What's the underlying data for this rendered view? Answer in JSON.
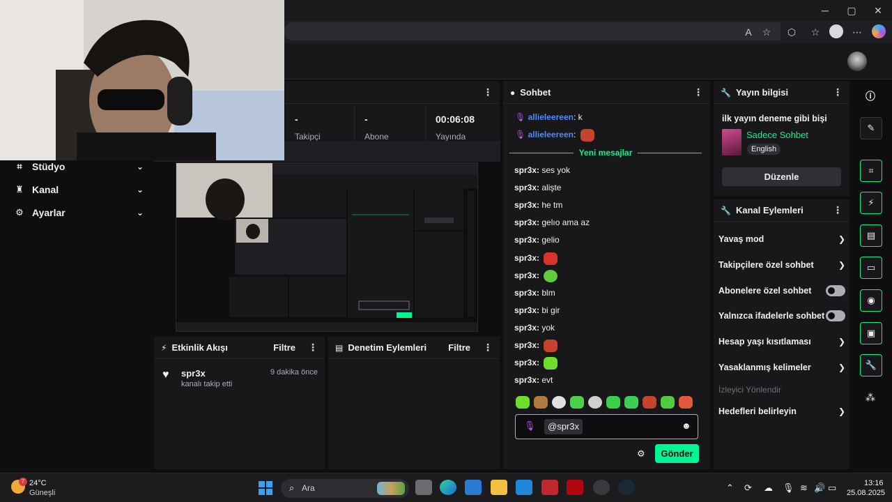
{
  "window": {
    "minimize": "─",
    "maximize": "▢",
    "close": "✕"
  },
  "toolbar": {
    "reader_label": "A",
    "star": "☆",
    "ext": "⬡",
    "fav": "☆",
    "more": "⋯"
  },
  "sidebar": {
    "items": [
      {
        "label": "Stüdyo",
        "icon": "⌗"
      },
      {
        "label": "Kanal",
        "icon": "♜"
      },
      {
        "label": "Ayarlar",
        "icon": "⚙"
      }
    ]
  },
  "stats": {
    "columns": [
      {
        "value": "-",
        "label": "Takipçi"
      },
      {
        "value": "-",
        "label": "Abone"
      },
      {
        "value": "00:06:08",
        "label": "Yayında"
      }
    ]
  },
  "chat": {
    "title": "Sohbet",
    "new_messages": "Yeni mesajlar",
    "top_messages": [
      {
        "user": "allieleereen",
        "text": "k"
      },
      {
        "user": "allieleereen",
        "text": ""
      }
    ],
    "messages": [
      {
        "user": "spr3x:",
        "text": "ses yok"
      },
      {
        "user": "spr3x:",
        "text": "alişte"
      },
      {
        "user": "spr3x:",
        "text": "he tm"
      },
      {
        "user": "spr3x:",
        "text": "gelıo ama az"
      },
      {
        "user": "spr3x:",
        "text": "gelio"
      },
      {
        "user": "spr3x:",
        "text": ""
      },
      {
        "user": "spr3x:",
        "text": ""
      },
      {
        "user": "spr3x:",
        "text": "blm"
      },
      {
        "user": "spr3x:",
        "text": "bi gir"
      },
      {
        "user": "spr3x:",
        "text": "yok"
      },
      {
        "user": "spr3x:",
        "text": ""
      },
      {
        "user": "spr3x:",
        "text": ""
      },
      {
        "user": "spr3x:",
        "text": "evt"
      }
    ],
    "input_value": "@spr3x",
    "send_label": "Gönder"
  },
  "yayin": {
    "title": "Yayın bilgisi",
    "stream_title": "ilk yayın deneme gibi bişi",
    "category": "Sadece Sohbet",
    "language": "English",
    "edit_label": "Düzenle"
  },
  "kanal": {
    "title": "Kanal Eylemleri",
    "rows": [
      {
        "label": "Yavaş mod",
        "kind": "chevron"
      },
      {
        "label": "Takipçilere özel sohbet",
        "kind": "chevron"
      },
      {
        "label": "Abonelere özel sohbet",
        "kind": "toggle"
      },
      {
        "label": "Yalnızca ifadelerle sohbet",
        "kind": "toggle"
      },
      {
        "label": "Hesap yaşı kısıtlaması",
        "kind": "chevron"
      },
      {
        "label": "Yasaklanmış kelimeler",
        "kind": "chevron"
      }
    ],
    "section": "İzleyici Yönlendir",
    "goals_label": "Hedefleri belirleyin"
  },
  "events": {
    "title": "Etkinlik Akışı",
    "filter": "Filtre",
    "item_user": "spr3x",
    "item_time": "9 dakika önce",
    "item_action": "kanalı takip etti"
  },
  "mod": {
    "title": "Denetim Eylemleri",
    "filter": "Filtre"
  },
  "taskbar": {
    "temp": "24°C",
    "weather": "Güneşli",
    "badge": "7",
    "search": "Ara",
    "time": "13:16",
    "date": "25.08.2025"
  },
  "colors": {
    "accent": "#00f593",
    "username": "#1f69ff",
    "bg": "#0e0e10",
    "panel": "#18181b"
  }
}
